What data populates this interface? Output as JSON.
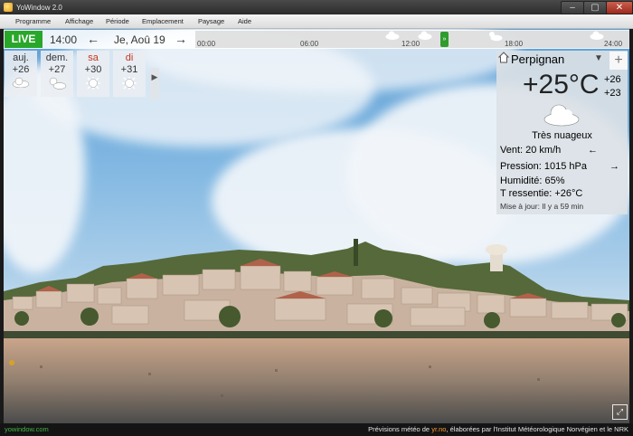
{
  "window": {
    "title": "YoWindow 2.0",
    "minimize": "–",
    "maximize": "▢",
    "close": "✕"
  },
  "menu": [
    "Programme",
    "Affichage",
    "Période",
    "Emplacement",
    "Paysage",
    "Aide"
  ],
  "timeline": {
    "live": "LIVE",
    "time": "14:00",
    "prev": "←",
    "date": "Je, Aoû 19",
    "next": "→",
    "ticks": [
      "00:00",
      "06:00",
      "12:00",
      "18:00",
      "24:00"
    ],
    "now_marker": "»"
  },
  "days": [
    {
      "name": "auj.",
      "temp": "+26",
      "icon": "cloud-icon"
    },
    {
      "name": "dem.",
      "temp": "+27",
      "icon": "sun-cloud-icon"
    },
    {
      "name": "sa",
      "temp": "+30",
      "icon": "sun-icon"
    },
    {
      "name": "di",
      "temp": "+31",
      "icon": "sun-icon"
    }
  ],
  "more_days": "▶",
  "panel": {
    "city": "Perpignan",
    "dropdown": "▼",
    "add": "+",
    "temp": "+25°C",
    "hi": "+26",
    "lo": "+23",
    "condition": "Très nuageux",
    "wind": "Vent:  20 km/h",
    "wind_arrow": "←",
    "pressure": "Pression:  1015 hPa",
    "pressure_arrow": "→",
    "humidity": "Humidité:  65%",
    "feels": "T ressentie:  +26°C",
    "updated": "Mise à jour:  Il y a 59 min"
  },
  "footer": {
    "site": "yowindow.com",
    "credit_pre": "Prévisions météo de ",
    "credit_src": "yr.no",
    "credit_post": ", élaborées par l'Institut Météorologique Norvégien et le NRK"
  },
  "fullscreen": "⤢",
  "colors": {
    "live": "#29a72a",
    "weekend": "#c6351f",
    "footer_link": "#45b245"
  }
}
